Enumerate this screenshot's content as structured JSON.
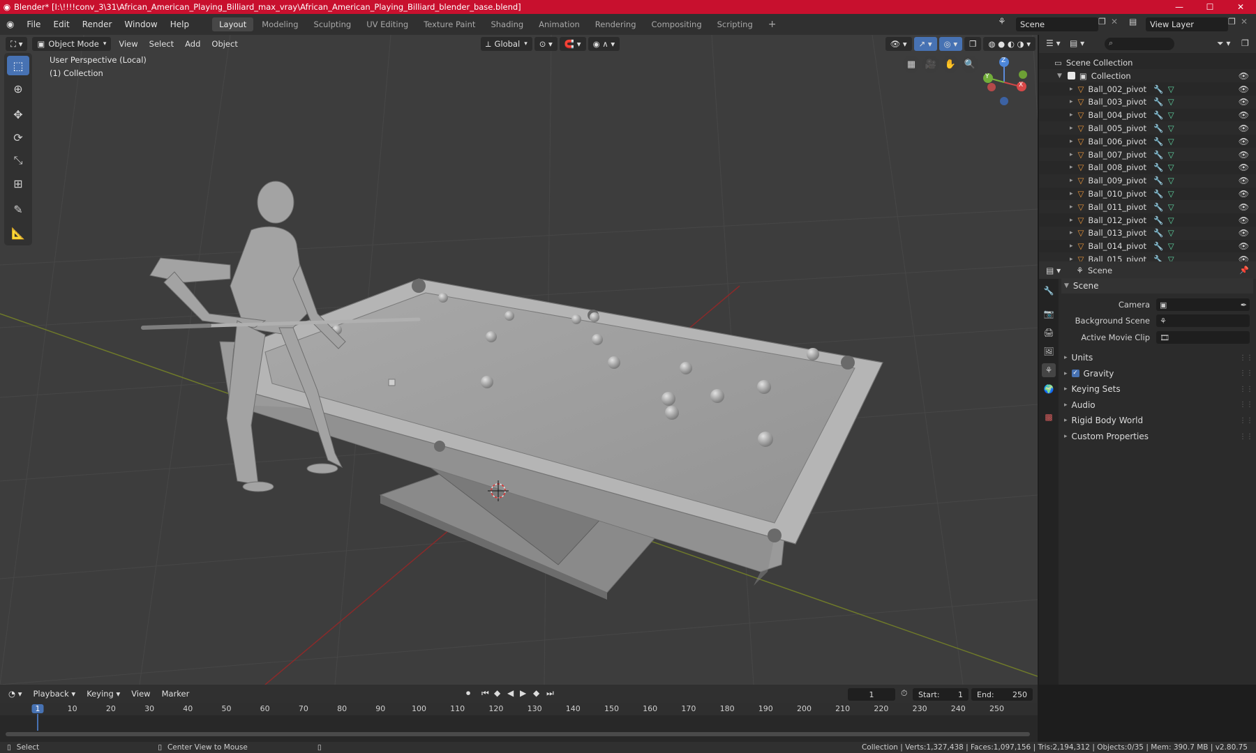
{
  "title_bar": {
    "title": "Blender* [I:\\!!!!conv_3\\31\\African_American_Playing_Billiard_max_vray\\African_American_Playing_Billiard_blender_base.blend]",
    "minimize": "—",
    "maximize": "☐",
    "close": "✕"
  },
  "menu": {
    "items": [
      "File",
      "Edit",
      "Render",
      "Window",
      "Help"
    ]
  },
  "workspaces": {
    "tabs": [
      "Layout",
      "Modeling",
      "Sculpting",
      "UV Editing",
      "Texture Paint",
      "Shading",
      "Animation",
      "Rendering",
      "Compositing",
      "Scripting"
    ],
    "add": "+"
  },
  "scene_selector": {
    "value": "Scene"
  },
  "view_layer_selector": {
    "value": "View Layer"
  },
  "viewport_header": {
    "mode": "Object Mode",
    "menus": [
      "View",
      "Select",
      "Add",
      "Object"
    ],
    "orientation": "Global"
  },
  "viewport": {
    "perspective_label": "User Perspective (Local)",
    "collection_label": "(1) Collection",
    "gizmo": {
      "x": "X",
      "y": "Y",
      "z": "Z"
    }
  },
  "outliner": {
    "root": "Scene Collection",
    "collection": "Collection",
    "objects": [
      "Ball_002_pivot",
      "Ball_003_pivot",
      "Ball_004_pivot",
      "Ball_005_pivot",
      "Ball_006_pivot",
      "Ball_007_pivot",
      "Ball_008_pivot",
      "Ball_009_pivot",
      "Ball_010_pivot",
      "Ball_011_pivot",
      "Ball_012_pivot",
      "Ball_013_pivot",
      "Ball_014_pivot",
      "Ball_015_pivot"
    ]
  },
  "properties": {
    "header_title": "Scene",
    "scene_panel": "Scene",
    "camera_label": "Camera",
    "background_label": "Background Scene",
    "movie_clip_label": "Active Movie Clip",
    "panels": [
      "Units",
      "Gravity",
      "Keying Sets",
      "Audio",
      "Rigid Body World",
      "Custom Properties"
    ]
  },
  "timeline": {
    "menus": [
      "Playback",
      "Keying",
      "View",
      "Marker"
    ],
    "current_frame": "1",
    "start_label": "Start:",
    "start": "1",
    "end_label": "End:",
    "end": "250",
    "ruler": [
      "1",
      "10",
      "20",
      "30",
      "40",
      "50",
      "60",
      "70",
      "80",
      "90",
      "100",
      "110",
      "120",
      "130",
      "140",
      "150",
      "160",
      "170",
      "180",
      "190",
      "200",
      "210",
      "220",
      "230",
      "240",
      "250"
    ]
  },
  "statusbar": {
    "select": "Select",
    "center_view": "Center View to Mouse",
    "stats": "Collection | Verts:1,327,438 | Faces:1,097,156 | Tris:2,194,312 | Objects:0/35 | Mem: 390.7 MB | v2.80.75"
  },
  "colors": {
    "title_bar": "#c8102e",
    "active_blue": "#4772b3",
    "object_orange": "#e8953a",
    "mesh_green": "#5ed3a0",
    "modifier_blue": "#6aa0e8"
  }
}
